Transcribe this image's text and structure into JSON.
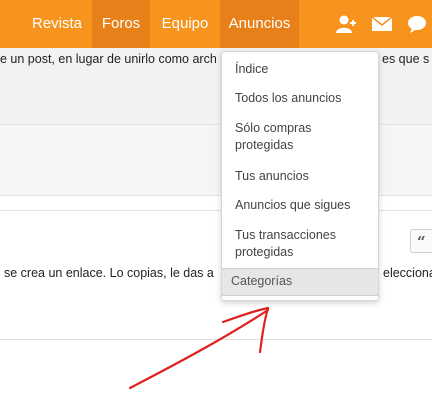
{
  "nav": {
    "items": [
      "Revista",
      "Foros",
      "Equipo",
      "Anuncios"
    ],
    "icons": [
      "add-contact-icon",
      "mail-icon",
      "chat-icon"
    ],
    "colors": {
      "bar": "#f7941d",
      "active": "#e8801a"
    }
  },
  "content": {
    "post_snippet": "e un post, en lugar de unirlo como arch",
    "post_snippet_right": "es que s",
    "card_snippet": "se crea un enlace. Lo copias, le das a",
    "card_snippet_right": "elecciona",
    "quote_button": "“"
  },
  "dropdown": {
    "items": [
      "Índice",
      "Todos los anuncios",
      "Sólo compras protegidas",
      "Tus anuncios",
      "Anuncios que sigues",
      "Tus transacciones protegidas"
    ],
    "footer": "Categorías"
  },
  "annotation": {
    "arrow_color": "#e02020"
  }
}
